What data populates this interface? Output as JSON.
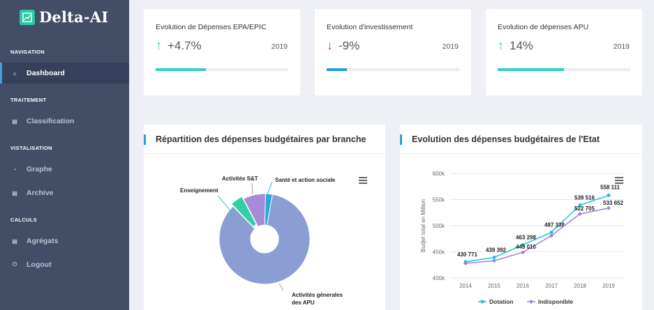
{
  "brand": {
    "name": "Delta-AI"
  },
  "sidebar": {
    "sections": [
      {
        "title": "NAVIGATION"
      },
      {
        "title": "TRAITEMENT"
      },
      {
        "title": "VISTALISATION"
      },
      {
        "title": "CALCULS"
      }
    ],
    "items": [
      {
        "label": "Dashboard",
        "icon": "home-icon"
      },
      {
        "label": "Classification",
        "icon": "list-icon"
      },
      {
        "label": "Graphe",
        "icon": "chart-icon"
      },
      {
        "label": "Archive",
        "icon": "archive-icon"
      },
      {
        "label": "Agrégats",
        "icon": "list-icon"
      },
      {
        "label": "Logout",
        "icon": "power-icon"
      }
    ]
  },
  "stats": [
    {
      "title": "Evolution de Dépenses EPA/EPIC",
      "value": "+4.7%",
      "year": "2019",
      "direction": "up",
      "progress": 0.38,
      "color": "#2ed1c6"
    },
    {
      "title": "Evolution d'investissement",
      "value": "-9%",
      "year": "2019",
      "direction": "down",
      "progress": 0.15,
      "color": "#1e9ee6"
    },
    {
      "title": "Evolution de dépenses APU",
      "value": "14%",
      "year": "2019",
      "direction": "up",
      "progress": 0.5,
      "color": "#2ed1c6"
    }
  ],
  "panels": {
    "pie_title": "Répartition des dépenses budgétaires par branche",
    "line_title": "Evolution des dépenses budgétaires de l'Etat"
  },
  "chart_data": [
    {
      "type": "pie",
      "title": "Répartition des dépenses budgétaires par branche",
      "slices": [
        {
          "label": "Activités génerales des APU",
          "value": 85,
          "color": "#8b9ed4"
        },
        {
          "label": "Enseignement",
          "value": 4.5,
          "color": "#2fd1a4"
        },
        {
          "label": "Activités S&T",
          "value": 8,
          "color": "#a78bd6"
        },
        {
          "label": "Santé et action sociale",
          "value": 2.5,
          "color": "#27a9e0"
        }
      ]
    },
    {
      "type": "line",
      "title": "Evolution des dépenses budgétaires de l'Etat",
      "ylabel": "Budjet total en Million",
      "ylim": [
        400000,
        600000
      ],
      "yticks": [
        "400k",
        "450k",
        "500k",
        "550k",
        "600k"
      ],
      "categories": [
        "2014",
        "2015",
        "2016",
        "2017",
        "2018",
        "2019"
      ],
      "series": [
        {
          "name": "Dotation",
          "color": "#1ec1e0",
          "values": [
            430771,
            439392,
            463298,
            487338,
            539516,
            558111
          ],
          "labels": [
            "430 771",
            "439 392",
            "463 298",
            "487 338",
            "539 516",
            "558 111"
          ]
        },
        {
          "name": "Indisponible",
          "color": "#a280d6",
          "values": [
            428000,
            433000,
            449010,
            481000,
            522705,
            533652
          ],
          "labels": [
            "",
            "",
            "449 010",
            "",
            "522 705",
            "533 652"
          ]
        }
      ]
    }
  ]
}
